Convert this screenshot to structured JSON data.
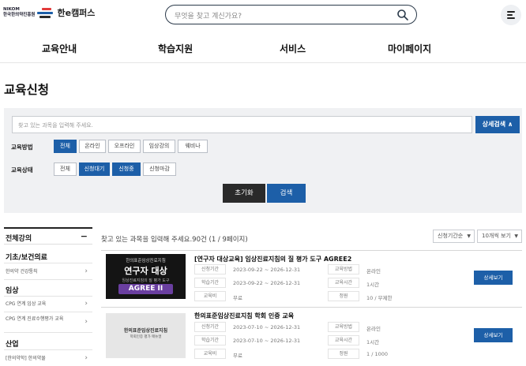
{
  "header": {
    "logo_org_line1": "NIKOM",
    "logo_org_line2": "한국한의약진흥원",
    "logo_text": "한e캠퍼스",
    "search_placeholder": "무엇을 찾고 계신가요?"
  },
  "nav": [
    "교육안내",
    "학습지원",
    "서비스",
    "마이페이지"
  ],
  "page_title": "교육신청",
  "filter": {
    "keyword_placeholder": "찾고 있는 과목을 입력해 주세요.",
    "advanced_label": "상세검색 ∧",
    "method_label": "교육방법",
    "methods": [
      "전체",
      "온라인",
      "오프라인",
      "임상강의",
      "웨비나"
    ],
    "status_label": "교육상태",
    "statuses": [
      "전체",
      "신청대기",
      "신청중",
      "신청마감"
    ],
    "reset_label": "초기화",
    "search_label": "검색"
  },
  "sidebar": {
    "header": "전체강의",
    "collapse": "−",
    "groups": [
      {
        "title": "기초/보건의료",
        "items": [
          "한의약 건강통칙"
        ]
      },
      {
        "title": "임상",
        "items": [
          "CPG 연계 임상 교육",
          "CPG 연계 진료수행평가 교육"
        ]
      },
      {
        "title": "산업",
        "items": [
          "[한의약학] 한의약물"
        ]
      }
    ]
  },
  "results": {
    "summary": "찾고 있는 과목을 입력해 주세요.90건 (1 / 9페이지)",
    "sort_label": "신청기간순",
    "page_size_label": "10개씩 보기",
    "courses": [
      {
        "title": "[연구자 대상교육] 임상진료지침의 질 평가 도구 AGREE2",
        "thumb_line1": "한의표준임상진료지침",
        "thumb_line2": "연구자 대상",
        "thumb_line3": "임상진료지침의 질 평가 도구",
        "thumb_line4": "AGREE II",
        "apply_period_label": "신청기간",
        "apply_period": "2023-09-22 ~ 2026-12-31",
        "study_period_label": "학습기간",
        "study_period": "2023-09-22 ~ 2026-12-31",
        "fee_label": "교육비",
        "fee": "무료",
        "method_label": "교육방법",
        "method": "온라인",
        "time_label": "교육시간",
        "time": "1시간",
        "quota_label": "정원",
        "quota": "10 / 무제한",
        "detail_label": "상세보기"
      },
      {
        "title": "한의표준임상진료지침 학회 인증 교육",
        "thumb_line1": "한의표준임상진료지침",
        "thumb_line2": "학회인증 평가 매뉴얼",
        "thumb_line3": "",
        "thumb_line4": "",
        "apply_period_label": "신청기간",
        "apply_period": "2023-07-10 ~ 2026-12-31",
        "study_period_label": "학습기간",
        "study_period": "2023-07-10 ~ 2026-12-31",
        "fee_label": "교육비",
        "fee": "무료",
        "method_label": "교육방법",
        "method": "온라인",
        "time_label": "교육시간",
        "time": "1시간",
        "quota_label": "정원",
        "quota": "1 / 1000",
        "detail_label": "상세보기"
      }
    ]
  },
  "colors": {
    "accent": "#1d5fa8",
    "dark": "#2a2a2a",
    "filter_bg": "#f0f1f3"
  }
}
